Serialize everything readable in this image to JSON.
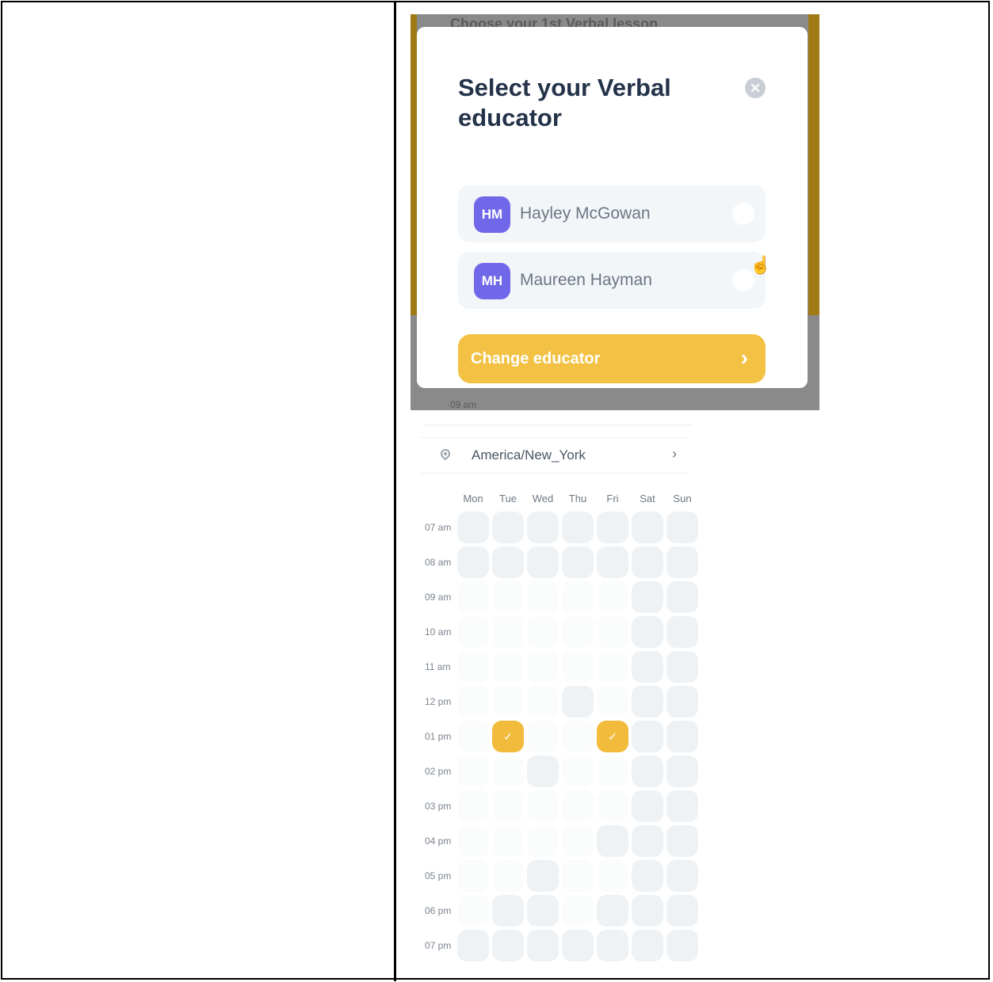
{
  "modal": {
    "background_title": "Choose your 1st Verbal lesson",
    "background_time": "09 am",
    "title": "Select your Verbal educator",
    "close_icon": "close-icon",
    "educators": [
      {
        "initials": "HM",
        "name": "Hayley McGowan",
        "selected": false
      },
      {
        "initials": "MH",
        "name": "Maureen Hayman",
        "selected": false
      }
    ],
    "cta_label": "Change educator",
    "cta_icon": "chevron-right-icon",
    "colors": {
      "accent": "#f3c244",
      "avatar": "#7068e8",
      "title": "#24334a"
    }
  },
  "calendar": {
    "timezone": "America/New_York",
    "pin_icon": "location-pin-icon",
    "chevron_icon": "chevron-right-icon",
    "days": [
      "Mon",
      "Tue",
      "Wed",
      "Thu",
      "Fri",
      "Sat",
      "Sun"
    ],
    "times": [
      "07 am",
      "08 am",
      "09 am",
      "10 am",
      "11 am",
      "12 pm",
      "01 pm",
      "02 pm",
      "03 pm",
      "04 pm",
      "05 pm",
      "06 pm",
      "07 pm"
    ],
    "grid": [
      [
        "g",
        "g",
        "g",
        "g",
        "g",
        "g",
        "g"
      ],
      [
        "g",
        "g",
        "g",
        "g",
        "g",
        "g",
        "g"
      ],
      [
        "w",
        "w",
        "w",
        "w",
        "w",
        "g",
        "g"
      ],
      [
        "w",
        "w",
        "w",
        "w",
        "w",
        "g",
        "g"
      ],
      [
        "w",
        "w",
        "w",
        "w",
        "w",
        "g",
        "g"
      ],
      [
        "w",
        "w",
        "w",
        "g",
        "w",
        "g",
        "g"
      ],
      [
        "w",
        "s",
        "w",
        "w",
        "s",
        "g",
        "g"
      ],
      [
        "w",
        "w",
        "g",
        "w",
        "w",
        "g",
        "g"
      ],
      [
        "w",
        "w",
        "w",
        "w",
        "w",
        "g",
        "g"
      ],
      [
        "w",
        "w",
        "w",
        "w",
        "g",
        "g",
        "g"
      ],
      [
        "w",
        "w",
        "g",
        "w",
        "w",
        "g",
        "g"
      ],
      [
        "w",
        "g",
        "g",
        "w",
        "g",
        "g",
        "g"
      ],
      [
        "g",
        "g",
        "g",
        "g",
        "g",
        "g",
        "g"
      ]
    ],
    "selected_mark": "✓",
    "colors": {
      "selected": "#f2bb3c",
      "unavailable": "#eef2f4"
    }
  }
}
